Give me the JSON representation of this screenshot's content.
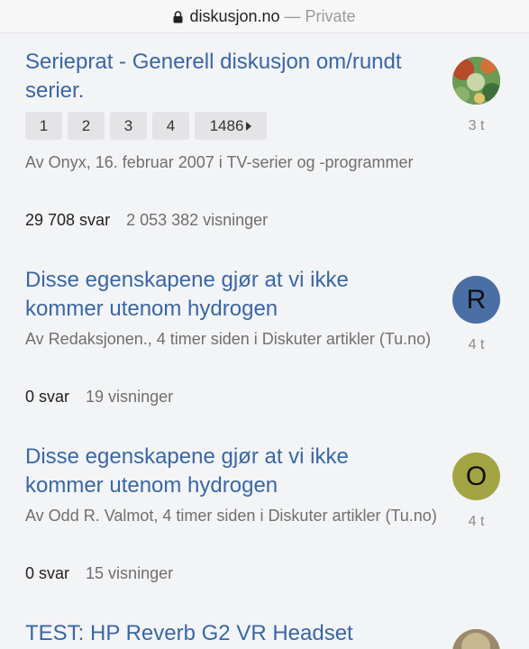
{
  "urlbar": {
    "domain": "diskusjon.no",
    "separator": "—",
    "mode": "Private"
  },
  "topics": [
    {
      "title": "Serieprat - Generell diskusjon om/rundt serier.",
      "pages": [
        "1",
        "2",
        "3",
        "4",
        "1486"
      ],
      "meta": "Av Onyx, 16. februar 2007 i TV-serier og -programmer",
      "replies": "29 708 svar",
      "views": "2 053 382 visninger",
      "avatar_type": "image",
      "time": "3 t"
    },
    {
      "title": "Disse egenskapene gjør at vi ikke kommer utenom hydrogen",
      "meta": "Av Redaksjonen., 4 timer siden i Diskuter artikler (Tu.no)",
      "replies": "0 svar",
      "views": "19 visninger",
      "avatar_letter": "R",
      "avatar_color": "#4a6fa5",
      "time": "4 t"
    },
    {
      "title": "Disse egenskapene gjør at vi ikke kommer utenom hydrogen",
      "meta": "Av Odd R. Valmot, 4 timer siden i Diskuter artikler (Tu.no)",
      "replies": "0 svar",
      "views": "15 visninger",
      "avatar_letter": "O",
      "avatar_color": "#a3a544",
      "time": "4 t"
    },
    {
      "title": "TEST: HP Reverb G2 VR Headset",
      "avatar_type": "image"
    }
  ]
}
